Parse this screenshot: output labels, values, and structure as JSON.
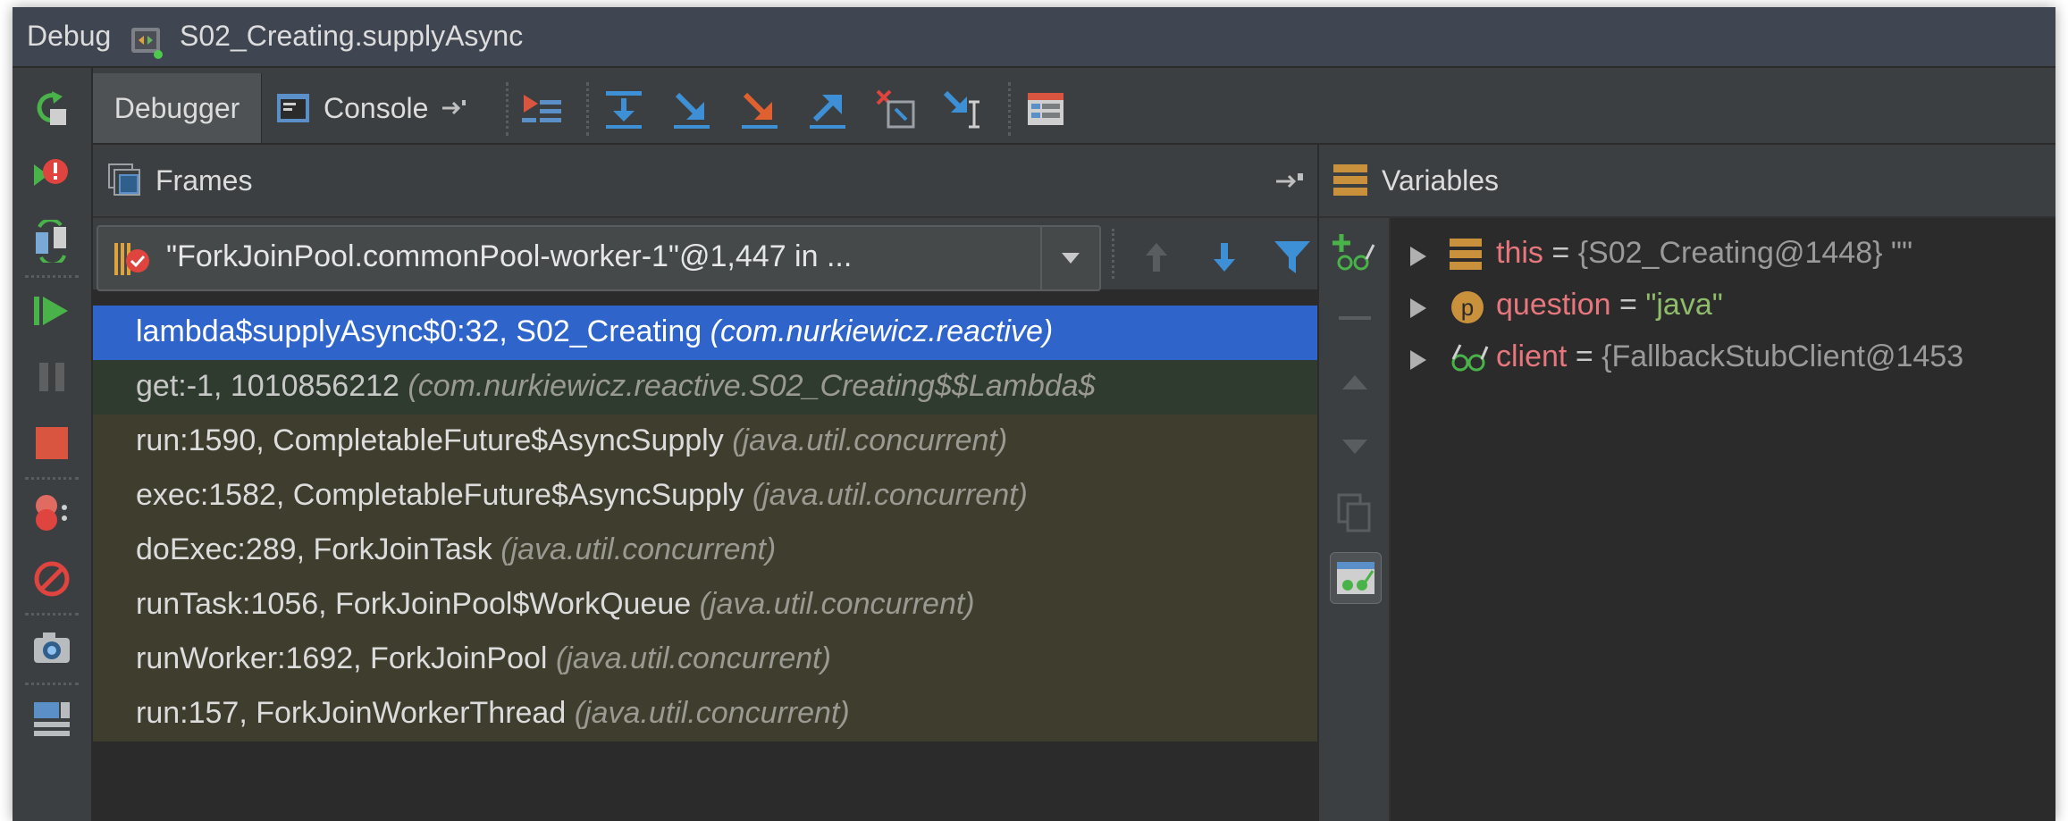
{
  "window": {
    "title_prefix": "Debug",
    "run_config": "S02_Creating.supplyAsync"
  },
  "tabs": {
    "debugger": "Debugger",
    "console": "Console"
  },
  "frames": {
    "header": "Frames",
    "thread_selector": "\"ForkJoinPool.commonPool-worker-1\"@1,447 in ...",
    "items": [
      {
        "method": "lambda$supplyAsync$0:32, S02_Creating",
        "pkg": "(com.nurkiewicz.reactive)",
        "selected": true,
        "library": false
      },
      {
        "method": "get:-1, 1010856212",
        "pkg": "(com.nurkiewicz.reactive.S02_Creating$$Lambda$",
        "selected": false,
        "library": true
      },
      {
        "method": "run:1590, CompletableFuture$AsyncSupply",
        "pkg": "(java.util.concurrent)",
        "selected": false,
        "library": false
      },
      {
        "method": "exec:1582, CompletableFuture$AsyncSupply",
        "pkg": "(java.util.concurrent)",
        "selected": false,
        "library": false
      },
      {
        "method": "doExec:289, ForkJoinTask",
        "pkg": "(java.util.concurrent)",
        "selected": false,
        "library": false
      },
      {
        "method": "runTask:1056, ForkJoinPool$WorkQueue",
        "pkg": "(java.util.concurrent)",
        "selected": false,
        "library": false
      },
      {
        "method": "runWorker:1692, ForkJoinPool",
        "pkg": "(java.util.concurrent)",
        "selected": false,
        "library": false
      },
      {
        "method": "run:157, ForkJoinWorkerThread",
        "pkg": "(java.util.concurrent)",
        "selected": false,
        "library": false
      }
    ]
  },
  "variables": {
    "header": "Variables",
    "items": [
      {
        "name": "this",
        "eq": "=",
        "value": "{S02_Creating@1448} \"\"",
        "icon": "field-icon",
        "value_is_string": false
      },
      {
        "name": "question",
        "eq": "=",
        "value": "\"java\"",
        "icon": "parameter-icon",
        "value_is_string": true
      },
      {
        "name": "client",
        "eq": "=",
        "value": "{FallbackStubClient@1453",
        "icon": "watch-icon",
        "value_is_string": false
      }
    ]
  },
  "colors": {
    "selected_frame": "#2f65ca",
    "library_frame": "#2f3b2e",
    "async_frame": "#3f3d2e",
    "var_name": "#e8767d",
    "var_string": "#8fbc6a",
    "panel_bg": "#2b2b2b",
    "toolbar_bg": "#3c3f41"
  }
}
